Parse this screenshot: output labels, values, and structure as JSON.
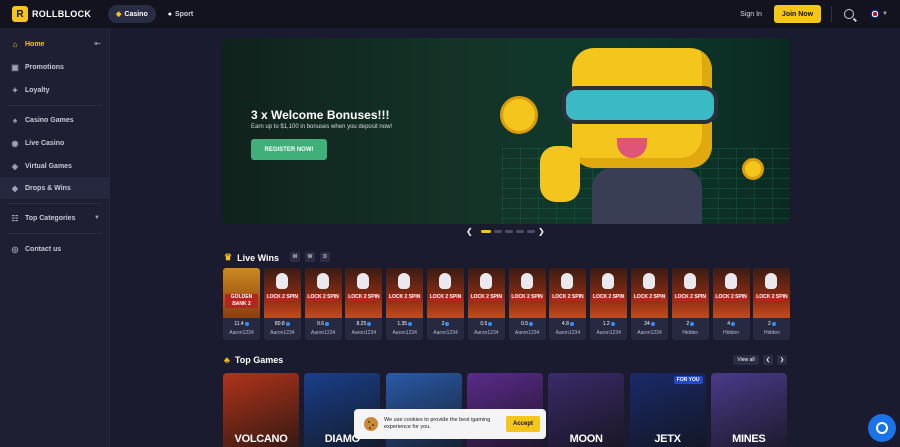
{
  "header": {
    "brand": "ROLLBLOCK",
    "logo_glyph": "R",
    "modes": [
      {
        "label": "Casino",
        "icon": "dice-icon",
        "active": true
      },
      {
        "label": "Sport",
        "icon": "ball-icon",
        "active": false
      }
    ],
    "signin": "Sign In",
    "join": "Join Now",
    "search_icon": "search-icon",
    "language_icon": "uk-flag-icon"
  },
  "sidebar": {
    "items": [
      {
        "label": "Home",
        "icon": "home-icon",
        "glyph": "⌂",
        "active": true
      },
      {
        "label": "Promotions",
        "icon": "gift-icon",
        "glyph": "▣"
      },
      {
        "label": "Loyalty",
        "icon": "medal-icon",
        "glyph": "✦"
      },
      {
        "label": "Casino Games",
        "icon": "casino-icon",
        "glyph": "♠"
      },
      {
        "label": "Live Casino",
        "icon": "live-icon",
        "glyph": "◉"
      },
      {
        "label": "Virtual Games",
        "icon": "controller-icon",
        "glyph": "◈"
      },
      {
        "label": "Drops & Wins",
        "icon": "drops-icon",
        "glyph": "◆"
      },
      {
        "label": "Top Categories",
        "icon": "categories-icon",
        "glyph": "☷"
      },
      {
        "label": "Contact us",
        "icon": "contact-icon",
        "glyph": "◎"
      }
    ]
  },
  "banner": {
    "title": "3 x Welcome Bonuses!!!",
    "subtitle": "Earn up to $1,100 in bonuses when you deposit now!",
    "cta": "REGISTER NOW!",
    "slides": 5,
    "active_slide": 0
  },
  "live_wins": {
    "title": "Live Wins",
    "periods": [
      "M",
      "W",
      "D"
    ],
    "cards": [
      {
        "game": "GOLDEN BANK 2",
        "amount": "11.4",
        "user": "Aaron1234",
        "golden": true
      },
      {
        "game": "LOCK 2 SPIN",
        "amount": "80.8",
        "user": "Aaron1234"
      },
      {
        "game": "LOCK 2 SPIN",
        "amount": "0.6",
        "user": "Aaron1234"
      },
      {
        "game": "LOCK 2 SPIN",
        "amount": "8.25",
        "user": "Aaron1234"
      },
      {
        "game": "LOCK 2 SPIN",
        "amount": "1.35",
        "user": "Aaron1234"
      },
      {
        "game": "LOCK 2 SPIN",
        "amount": "2",
        "user": "Aaron1234"
      },
      {
        "game": "LOCK 2 SPIN",
        "amount": "0.5",
        "user": "Aaron1234"
      },
      {
        "game": "LOCK 2 SPIN",
        "amount": "0.5",
        "user": "Aaron1234"
      },
      {
        "game": "LOCK 2 SPIN",
        "amount": "4.8",
        "user": "Aaron1234"
      },
      {
        "game": "LOCK 2 SPIN",
        "amount": "1.2",
        "user": "Aaron1234"
      },
      {
        "game": "LOCK 2 SPIN",
        "amount": "24",
        "user": "Aaron1234"
      },
      {
        "game": "LOCK 2 SPIN",
        "amount": "2",
        "user": "Hidden"
      },
      {
        "game": "LOCK 2 SPIN",
        "amount": "4",
        "user": "Hidden"
      },
      {
        "game": "LOCK 2 SPIN",
        "amount": "2",
        "user": "Hidden"
      }
    ]
  },
  "top_games": {
    "title": "Top Games",
    "view_all": "View all",
    "games": [
      {
        "name": "VOLCANO",
        "bg": "#b0341a"
      },
      {
        "name": "DIAMO",
        "bg": "#1a3f8a"
      },
      {
        "name": "",
        "bg": "#2a5aa8"
      },
      {
        "name": "",
        "bg": "#5a2a8a"
      },
      {
        "name": "MOON",
        "bg": "#3a2a6a"
      },
      {
        "name": "JETX",
        "bg": "#1a2a6a",
        "badge": "FOR YOU"
      },
      {
        "name": "MINES",
        "bg": "#4a3a8a"
      }
    ]
  },
  "cookie": {
    "text": "We use cookies to provide the best igaming experience for you.",
    "accept": "Accept"
  },
  "colors": {
    "accent": "#f5c518",
    "background": "#1a1b2e",
    "cta_green": "#3fb07a"
  }
}
